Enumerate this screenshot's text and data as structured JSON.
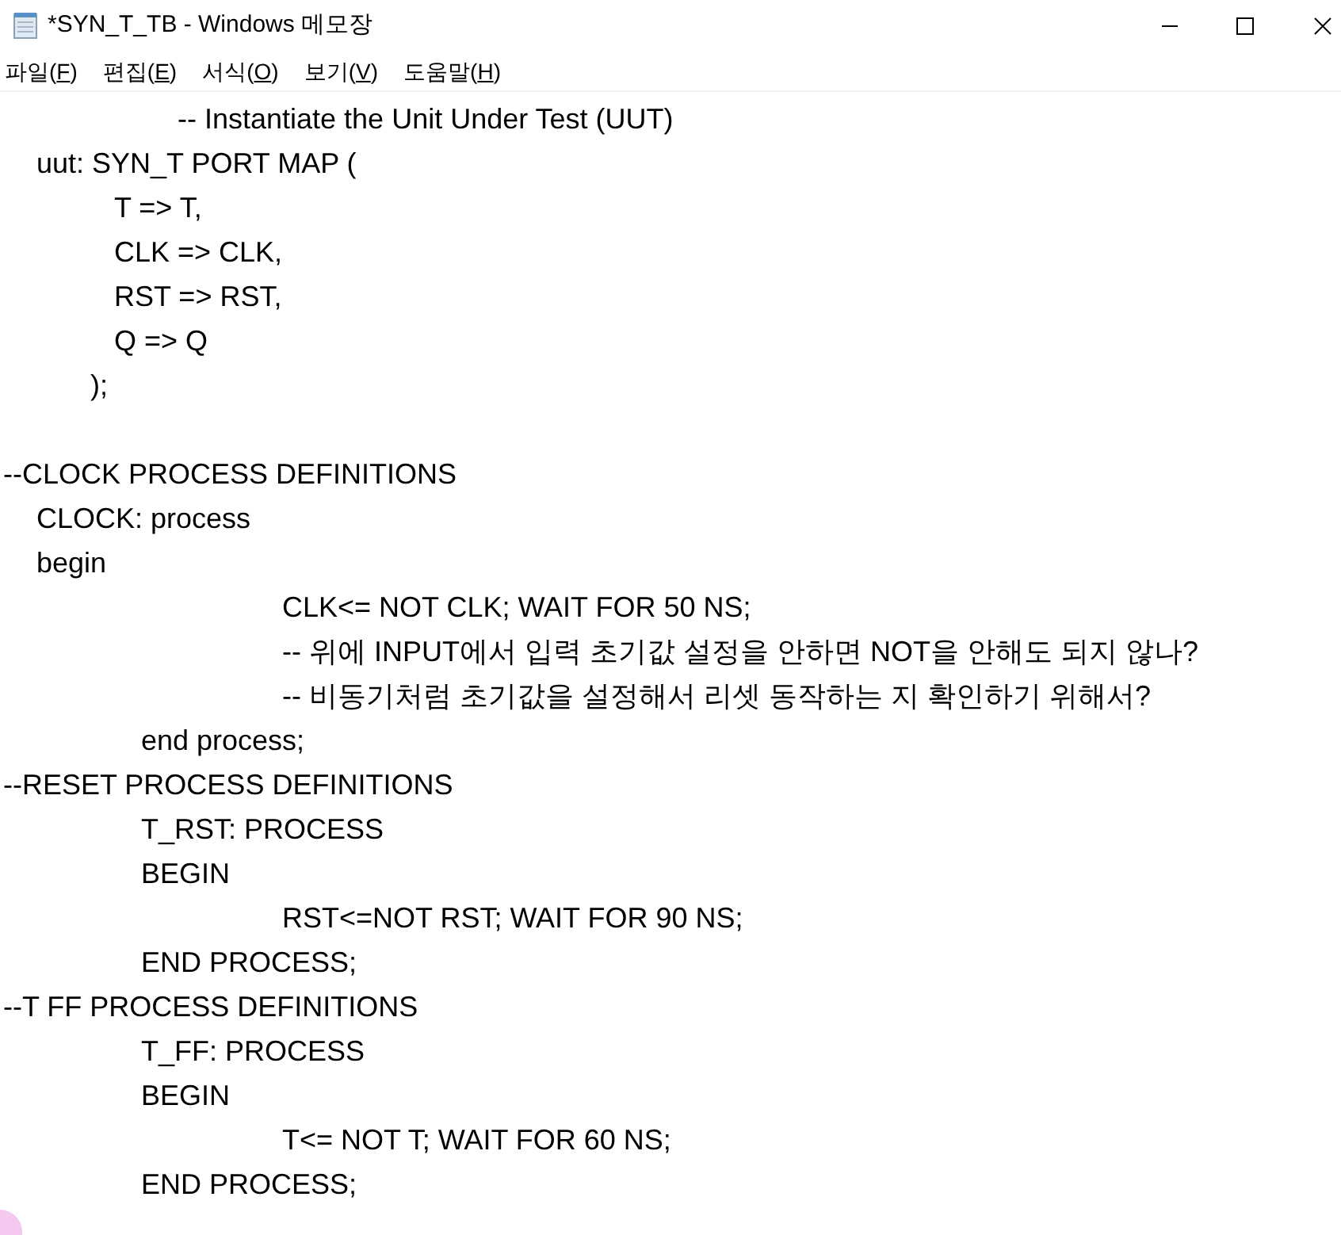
{
  "window": {
    "title": "*SYN_T_TB - Windows 메모장"
  },
  "menu_bar": [
    {
      "before": "파일(",
      "key": "F",
      "after": ")"
    },
    {
      "before": "편집(",
      "key": "E",
      "after": ")"
    },
    {
      "before": "서식(",
      "key": "O",
      "after": ")"
    },
    {
      "before": "보기(",
      "key": "V",
      "after": ")"
    },
    {
      "before": "도움말(",
      "key": "H",
      "after": ")"
    }
  ],
  "editor": {
    "lines": [
      {
        "kind": "comment",
        "text": "-- Instantiate the Unit Under Test (UUT)"
      },
      {
        "kind": "spaced",
        "text": "uut: SYN_T PORT MAP ("
      },
      {
        "kind": "mapping",
        "text": "T => T,"
      },
      {
        "kind": "mapping",
        "text": "CLK => CLK,"
      },
      {
        "kind": "mapping",
        "text": "RST => RST,"
      },
      {
        "kind": "mapping",
        "text": "Q => Q"
      },
      {
        "kind": "closer",
        "text": ");"
      },
      {
        "kind": "blank"
      },
      {
        "kind": "flush",
        "text": "--CLOCK PROCESS DEFINITIONS"
      },
      {
        "kind": "spaced",
        "text": "CLOCK: process"
      },
      {
        "kind": "spaced",
        "text": "begin"
      },
      {
        "kind": "doubletab",
        "text": "CLK<= NOT CLK; WAIT FOR 50 NS;"
      },
      {
        "kind": "doubletab",
        "text": "-- 위에 INPUT에서 입력 초기값 설정을 안하면 NOT을 안해도 되지 않나?"
      },
      {
        "kind": "doubletab",
        "text": "-- 비동기처럼 초기값을 설정해서 리셋 동작하는 지 확인하기 위해서?"
      },
      {
        "kind": "tab",
        "text": "end process;"
      },
      {
        "kind": "flush",
        "text": "--RESET PROCESS DEFINITIONS"
      },
      {
        "kind": "tab",
        "text": "T_RST: PROCESS"
      },
      {
        "kind": "tab",
        "text": "BEGIN"
      },
      {
        "kind": "doubletab",
        "text": "RST<=NOT RST; WAIT FOR 90 NS;"
      },
      {
        "kind": "tab",
        "text": "END PROCESS;"
      },
      {
        "kind": "flush",
        "text": "--T FF PROCESS DEFINITIONS"
      },
      {
        "kind": "tab",
        "text": "T_FF: PROCESS"
      },
      {
        "kind": "tab",
        "text": "BEGIN"
      },
      {
        "kind": "doubletab",
        "text": "T<= NOT T; WAIT FOR 60 NS;"
      },
      {
        "kind": "tab",
        "text": "END PROCESS;"
      }
    ]
  }
}
